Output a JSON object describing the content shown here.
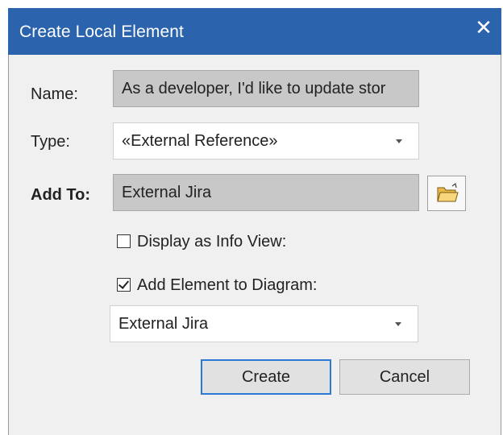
{
  "dialog": {
    "title": "Create Local Element",
    "close_glyph": "✕"
  },
  "name_field": {
    "label": "Name:",
    "value": "As a developer, I'd like to update stor"
  },
  "type_field": {
    "label": "Type:",
    "value": "«External Reference»"
  },
  "add_to_field": {
    "label": "Add To:",
    "value": "External Jira",
    "browse_icon": "folder-open-icon"
  },
  "display_info_view": {
    "label": "Display as Info View:",
    "checked": false
  },
  "add_to_diagram": {
    "label": "Add Element to Diagram:",
    "checked": true
  },
  "diagram_select": {
    "value": "External Jira"
  },
  "buttons": {
    "create": "Create",
    "cancel": "Cancel"
  },
  "colors": {
    "titlebar": "#2b63ad",
    "default_button_border": "#2a7ad4",
    "folder_icon": "#f2c14e"
  }
}
